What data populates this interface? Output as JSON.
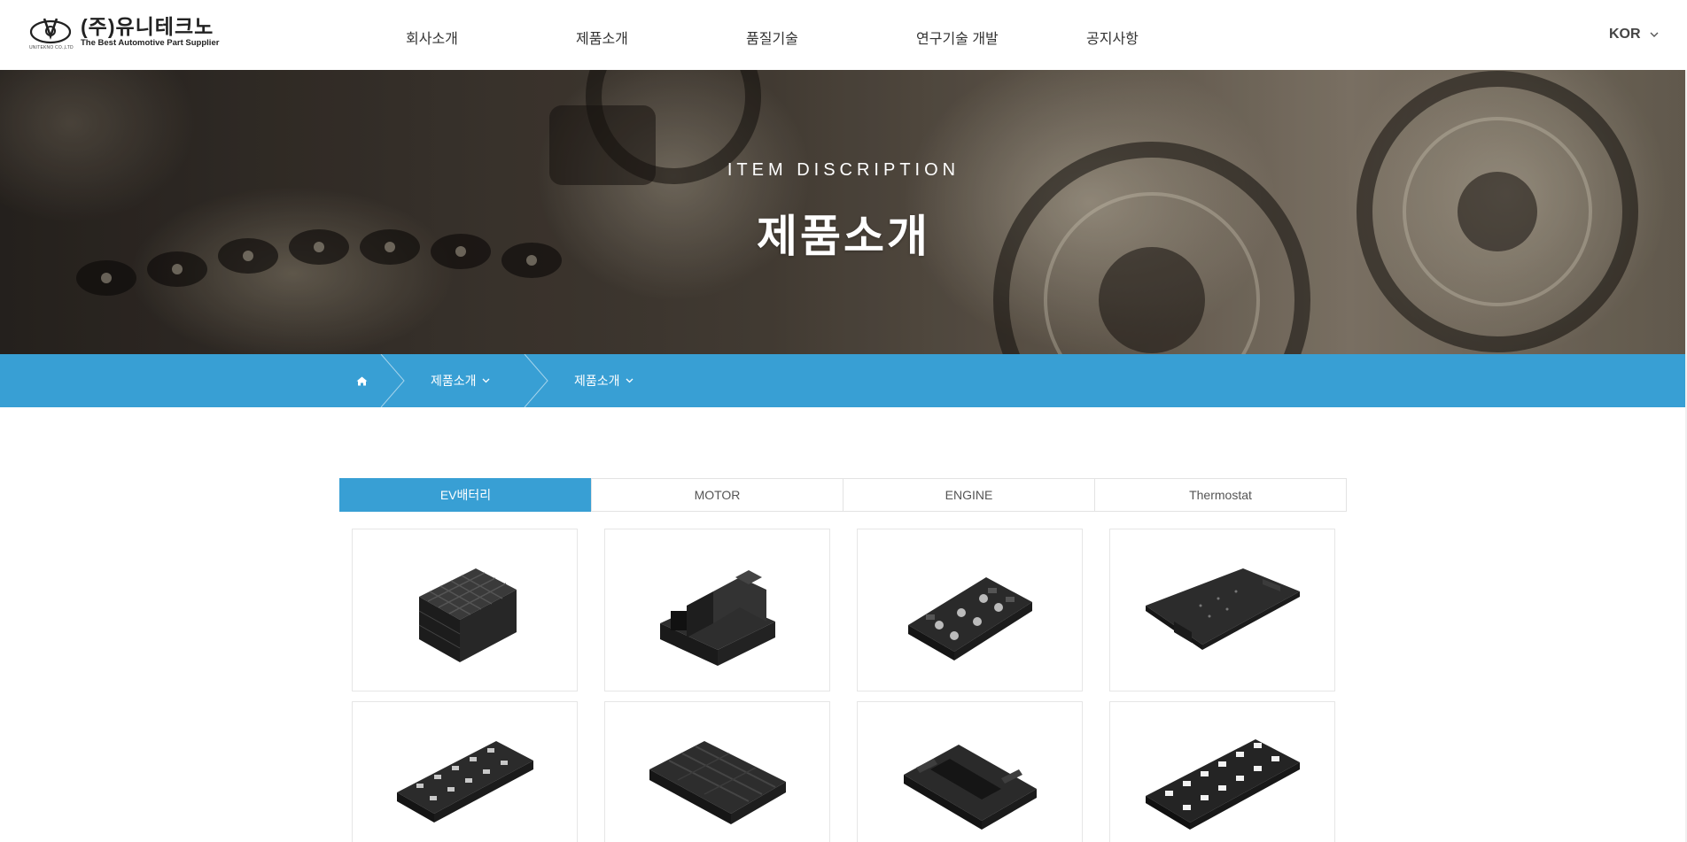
{
  "header": {
    "logo": {
      "name": "(주)유니테크노",
      "tagline": "The Best Automotive Part Supplier",
      "mark_caption": "UNITEKNO CO.,LTD"
    },
    "nav": [
      {
        "label": "회사소개"
      },
      {
        "label": "제품소개"
      },
      {
        "label": "품질기술"
      },
      {
        "label": "연구기술 개발"
      },
      {
        "label": "공지사항"
      }
    ],
    "language": {
      "label": "KOR",
      "icon": "chevron-down-icon"
    }
  },
  "hero": {
    "eyebrow": "ITEM DISCRIPTION",
    "title": "제품소개"
  },
  "breadcrumb": {
    "home_icon": "home-icon",
    "items": [
      {
        "label": "제품소개"
      },
      {
        "label": "제품소개"
      }
    ],
    "bar_color": "#389fd4"
  },
  "tabs": {
    "items": [
      {
        "label": "EV배터리",
        "active": true
      },
      {
        "label": "MOTOR",
        "active": false
      },
      {
        "label": "ENGINE",
        "active": false
      },
      {
        "label": "Thermostat",
        "active": false
      }
    ],
    "accent": "#389fd4"
  },
  "products": [
    {
      "icon": "battery-module-case-icon"
    },
    {
      "icon": "battery-housing-icon"
    },
    {
      "icon": "busbar-holder-icon"
    },
    {
      "icon": "cover-plate-icon"
    },
    {
      "icon": "cell-frame-icon"
    },
    {
      "icon": "tray-icon"
    },
    {
      "icon": "bracket-icon"
    },
    {
      "icon": "frame-grid-icon"
    }
  ]
}
